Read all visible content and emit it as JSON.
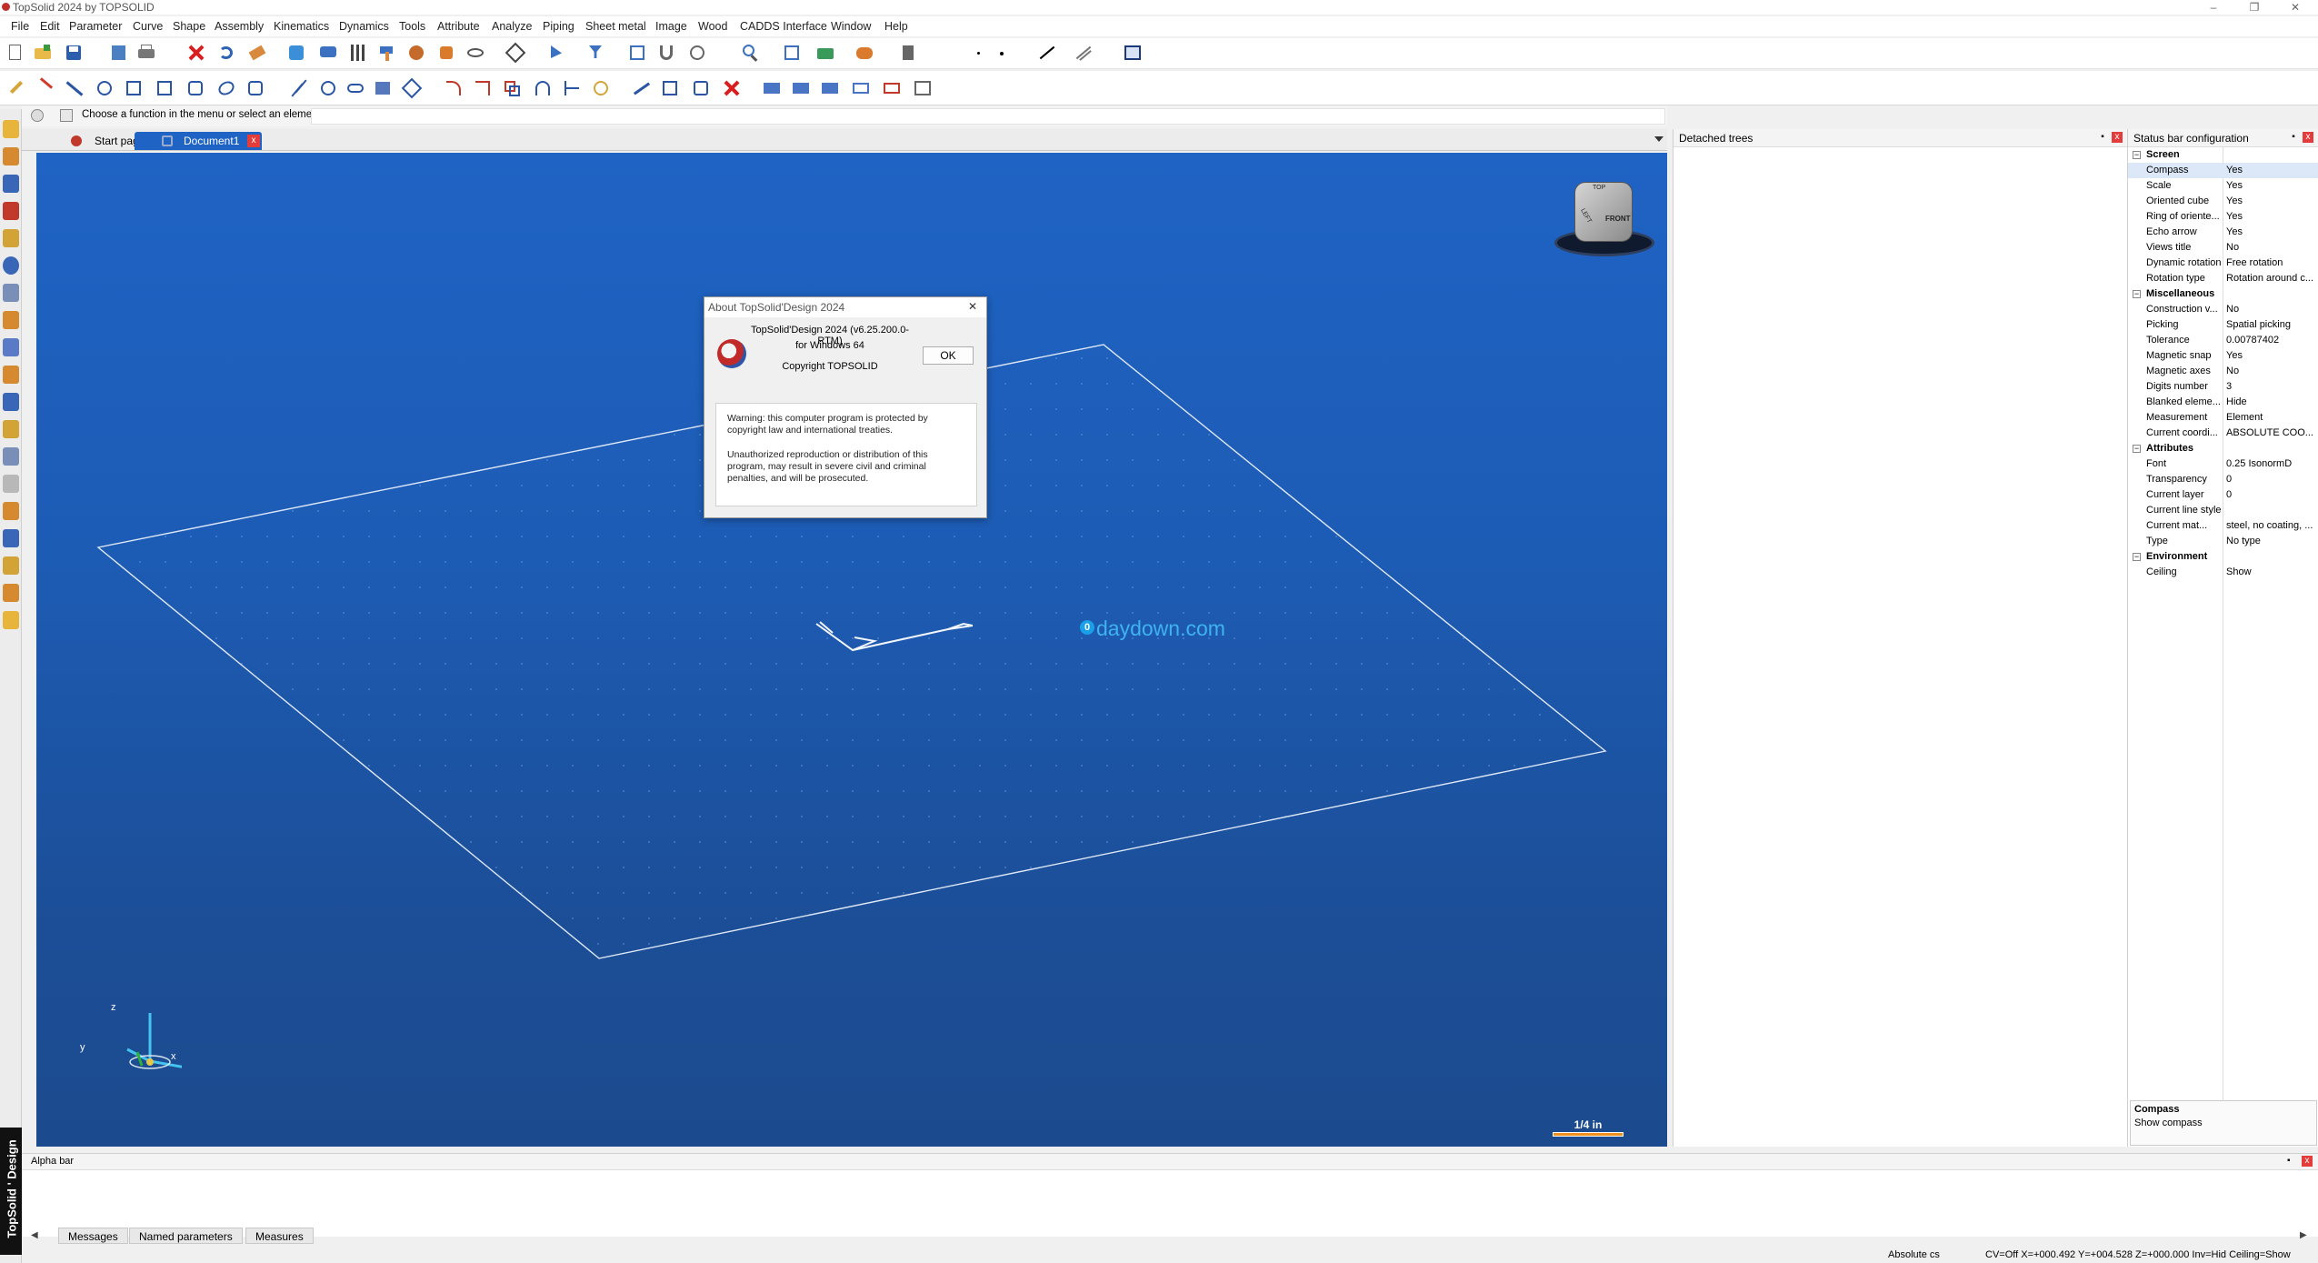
{
  "window": {
    "title": "TopSolid 2024 by TOPSOLID",
    "controls": [
      "–",
      "❐",
      "✕"
    ]
  },
  "menu": [
    "File",
    "Edit",
    "Parameter",
    "Curve",
    "Shape",
    "Assembly",
    "Kinematics",
    "Dynamics",
    "Tools",
    "Attribute",
    "Analyze",
    "Piping",
    "Sheet metal",
    "Image",
    "Wood",
    "CADDS Interface",
    "Window",
    "Help"
  ],
  "hint": "Choose a function in the menu or select an element",
  "tabs": {
    "start": "Start page",
    "doc": "Document1",
    "close": "x"
  },
  "viewport": {
    "watermark": "daydown.com",
    "watermark_badge": "0",
    "scale_label": "1/4 in",
    "cube_front": "FRONT",
    "cube_top": "TOP",
    "cube_left": "LEFT",
    "axis_x": "x",
    "axis_y": "y",
    "axis_z": "z"
  },
  "about": {
    "title": "About TopSolid'Design 2024",
    "line1": "TopSolid'Design 2024 (v6.25.200.0-RTM)",
    "line2": "for Windows 64",
    "line3": "Copyright TOPSOLID",
    "ok": "OK",
    "warn1": "Warning: this computer program is protected by copyright law and international treaties.",
    "warn2": "Unauthorized reproduction or distribution of this program, may result in severe civil and criminal penalties, and will be prosecuted.",
    "close": "✕"
  },
  "detached": {
    "title": "Detached trees"
  },
  "props": {
    "title": "Status bar configuration",
    "rows": [
      {
        "k": "Screen",
        "v": "",
        "sec": true
      },
      {
        "k": "Compass",
        "v": "Yes",
        "sel": true
      },
      {
        "k": "Scale",
        "v": "Yes"
      },
      {
        "k": "Oriented cube",
        "v": "Yes"
      },
      {
        "k": "Ring of oriente...",
        "v": "Yes"
      },
      {
        "k": "Echo arrow",
        "v": "Yes"
      },
      {
        "k": "Views title",
        "v": "No"
      },
      {
        "k": "Dynamic rotation",
        "v": "Free rotation"
      },
      {
        "k": "Rotation type",
        "v": "Rotation around c..."
      },
      {
        "k": "Miscellaneous",
        "v": "",
        "sec": true
      },
      {
        "k": "Construction v...",
        "v": "No"
      },
      {
        "k": "Picking",
        "v": "Spatial picking"
      },
      {
        "k": "Tolerance",
        "v": "0.00787402"
      },
      {
        "k": "Magnetic snap",
        "v": "Yes"
      },
      {
        "k": "Magnetic axes",
        "v": "No"
      },
      {
        "k": "Digits number",
        "v": "3"
      },
      {
        "k": "Blanked eleme...",
        "v": "Hide"
      },
      {
        "k": "Measurement",
        "v": "Element"
      },
      {
        "k": "Current coordi...",
        "v": "ABSOLUTE COO..."
      },
      {
        "k": "Attributes",
        "v": "",
        "sec": true
      },
      {
        "k": "Font",
        "v": "0.25  IsonormD"
      },
      {
        "k": "Transparency",
        "v": "0"
      },
      {
        "k": "Current layer",
        "v": "0"
      },
      {
        "k": "Current line style",
        "v": ""
      },
      {
        "k": "Current mat...",
        "v": "steel, no coating, ..."
      },
      {
        "k": "Type",
        "v": "No type"
      },
      {
        "k": "Environment",
        "v": "",
        "sec": true
      },
      {
        "k": "Ceiling",
        "v": "Show"
      }
    ],
    "desc_title": "Compass",
    "desc_text": "Show compass"
  },
  "alpha": {
    "title": "Alpha bar",
    "tabs": [
      "Messages",
      "Named parameters",
      "Measures"
    ]
  },
  "status": {
    "cs": "Absolute cs",
    "coords": "CV=Off  X=+000.492  Y=+004.528  Z=+000.000  Inv=Hid  Ceiling=Show"
  },
  "brand": "TopSolid ' Design"
}
